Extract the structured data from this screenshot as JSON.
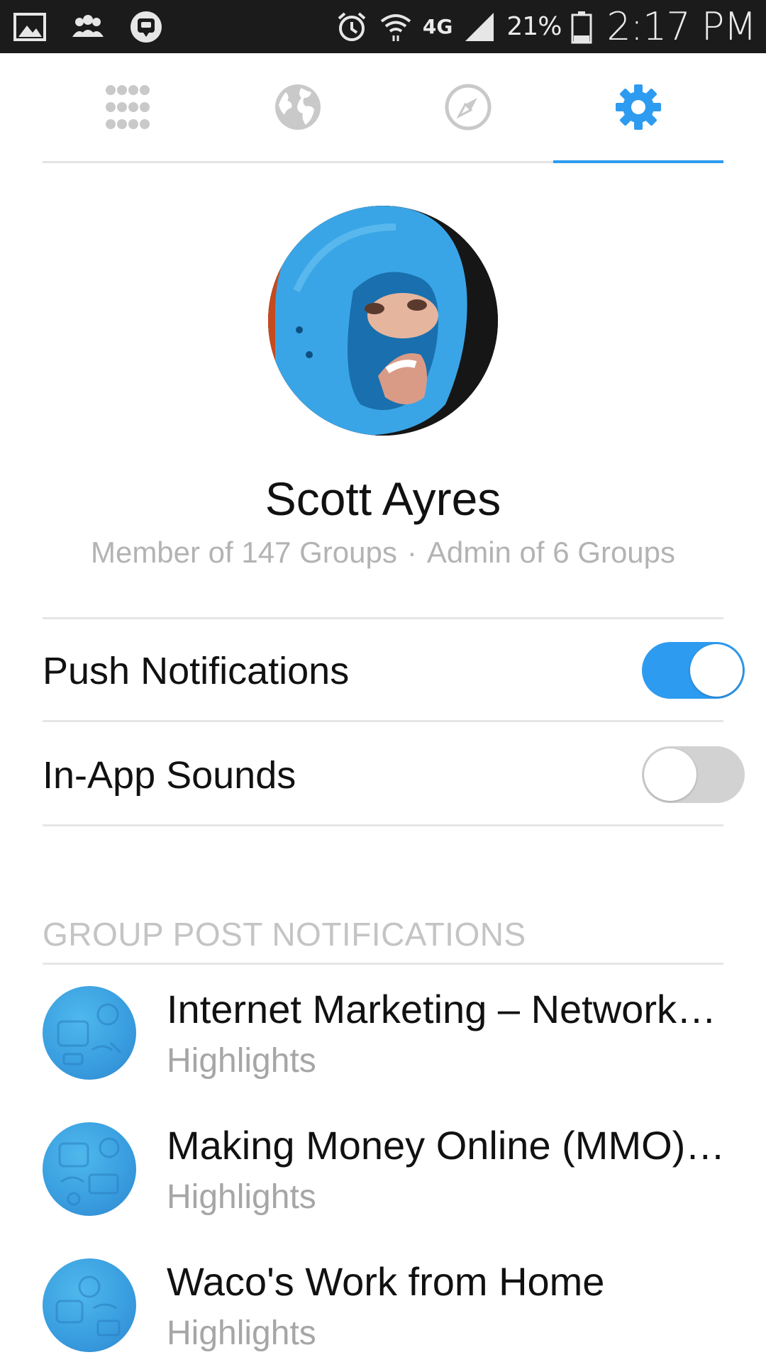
{
  "status_bar": {
    "battery_percent": "21%",
    "time": "2:17 PM",
    "network": "4G",
    "icons": [
      "gallery-icon",
      "people-icon",
      "chat-app-icon",
      "alarm-icon",
      "wifi-icon",
      "4g-lte-icon",
      "signal-icon",
      "battery-icon"
    ]
  },
  "tabs": [
    {
      "icon": "apps-grid-icon",
      "active": false
    },
    {
      "icon": "globe-icon",
      "active": false
    },
    {
      "icon": "compass-icon",
      "active": false
    },
    {
      "icon": "gear-icon",
      "active": true
    }
  ],
  "profile": {
    "name": "Scott Ayres",
    "member_of": "Member of 147 Groups",
    "separator": "·",
    "admin_of": "Admin of 6 Groups"
  },
  "settings": {
    "push_notifications": {
      "label": "Push Notifications",
      "enabled": true
    },
    "in_app_sounds": {
      "label": "In-App Sounds",
      "enabled": false
    }
  },
  "group_section": {
    "header": "GROUP POST NOTIFICATIONS",
    "groups": [
      {
        "title": "Internet Marketing – Network…",
        "subtitle": "Highlights"
      },
      {
        "title": "Making Money Online (MMO)…",
        "subtitle": "Highlights"
      },
      {
        "title": "Waco's Work from Home",
        "subtitle": "Highlights"
      }
    ]
  },
  "colors": {
    "accent": "#2d9bf0",
    "status_bar_bg": "#1b1b1b",
    "muted_text": "#b3b3b3",
    "toggle_off": "#d2d2d2"
  }
}
